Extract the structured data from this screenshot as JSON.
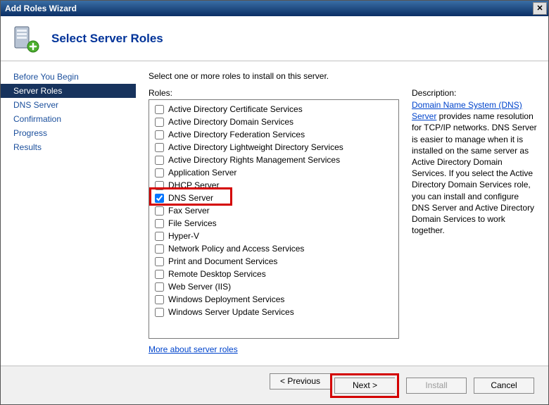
{
  "window": {
    "title": "Add Roles Wizard"
  },
  "header": {
    "title": "Select Server Roles"
  },
  "sidebar": {
    "items": [
      {
        "label": "Before You Begin",
        "selected": false
      },
      {
        "label": "Server Roles",
        "selected": true
      },
      {
        "label": "DNS Server",
        "selected": false
      },
      {
        "label": "Confirmation",
        "selected": false
      },
      {
        "label": "Progress",
        "selected": false
      },
      {
        "label": "Results",
        "selected": false
      }
    ]
  },
  "main": {
    "instruction": "Select one or more roles to install on this server.",
    "roles_label": "Roles:",
    "description_label": "Description:",
    "more_link": "More about server roles",
    "description_link": "Domain Name System (DNS) Server",
    "description_rest": " provides name resolution for TCP/IP networks. DNS Server is easier to manage when it is installed on the same server as Active Directory Domain Services. If you select the Active Directory Domain Services role, you can install and configure DNS Server and Active Directory Domain Services to work together.",
    "roles": [
      {
        "label": "Active Directory Certificate Services",
        "checked": false
      },
      {
        "label": "Active Directory Domain Services",
        "checked": false
      },
      {
        "label": "Active Directory Federation Services",
        "checked": false
      },
      {
        "label": "Active Directory Lightweight Directory Services",
        "checked": false
      },
      {
        "label": "Active Directory Rights Management Services",
        "checked": false
      },
      {
        "label": "Application Server",
        "checked": false
      },
      {
        "label": "DHCP Server",
        "checked": false
      },
      {
        "label": "DNS Server",
        "checked": true,
        "highlighted": true
      },
      {
        "label": "Fax Server",
        "checked": false
      },
      {
        "label": "File Services",
        "checked": false
      },
      {
        "label": "Hyper-V",
        "checked": false
      },
      {
        "label": "Network Policy and Access Services",
        "checked": false
      },
      {
        "label": "Print and Document Services",
        "checked": false
      },
      {
        "label": "Remote Desktop Services",
        "checked": false
      },
      {
        "label": "Web Server (IIS)",
        "checked": false
      },
      {
        "label": "Windows Deployment Services",
        "checked": false
      },
      {
        "label": "Windows Server Update Services",
        "checked": false
      }
    ]
  },
  "footer": {
    "previous": "< Previous",
    "next": "Next >",
    "install": "Install",
    "cancel": "Cancel"
  }
}
